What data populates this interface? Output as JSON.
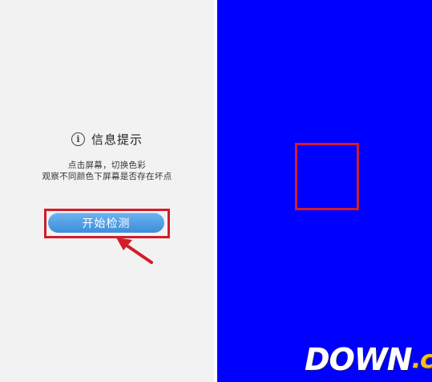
{
  "info_dialog": {
    "icon": "info-circle-icon",
    "title": "信息提示",
    "line1": "点击屏幕，切换色彩",
    "line2": "观察不同颜色下屏幕是否存在坏点"
  },
  "start_button": {
    "label": "开始检测"
  },
  "test_screen": {
    "color": "#0000ff"
  },
  "annotation": {
    "highlight_color": "#d31c2b"
  },
  "watermark": {
    "main": "DOWN",
    "suffix": ".cc"
  }
}
